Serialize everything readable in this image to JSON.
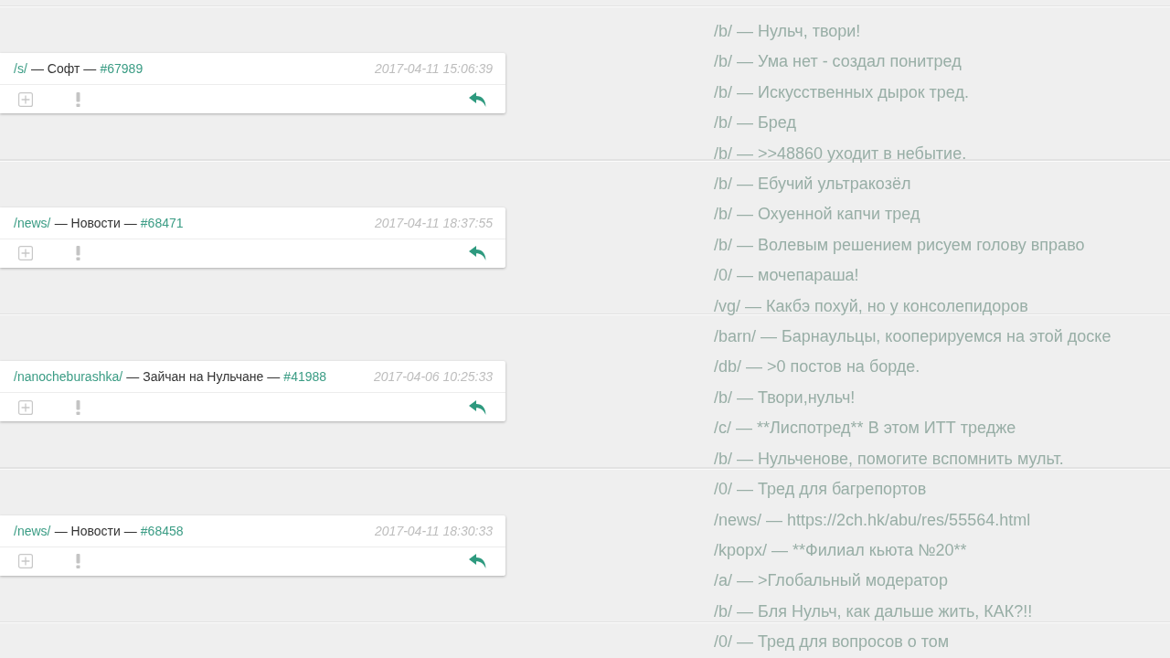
{
  "threads": [
    {
      "board": "/s/",
      "title": "— Софт —",
      "post": "#67989",
      "date": "2017-04-11 15:06:39"
    },
    {
      "board": "/news/",
      "title": "— Новости —",
      "post": "#68471",
      "date": "2017-04-11 18:37:55"
    },
    {
      "board": "/nanocheburashka/",
      "title": "— Зайчан на Нульчане —",
      "post": "#41988",
      "date": "2017-04-06 10:25:33"
    },
    {
      "board": "/news/",
      "title": "— Новости —",
      "post": "#68458",
      "date": "2017-04-11 18:30:33"
    }
  ],
  "recent_threads": [
    "/b/ — Нульч, твори!",
    "/b/ — Ума нет - создал понитред",
    "/b/ — Искусственных дырок тред.",
    "/b/ — Бред",
    "/b/ — >>48860 уходит в небытие.",
    "/b/ — Ебучий ультракозёл",
    "/b/ — Охуенной капчи тред",
    "/b/ — Волевым решением рисуем голову вправо",
    "/0/ — мочепараша!",
    "/vg/ — Какбэ похуй, но у консолепидоров",
    "/barn/ — Барнаульцы, кооперируемся на этой доске",
    "/db/ — >0 постов на борде.",
    "/b/ — Твори,нульч!",
    "/c/ — **Лиспотред** В этом ИТТ тредже",
    "/b/ — Нульченове, помогите вспомнить мульт.",
    "/0/ — Тред для багрепортов",
    "/news/ — https://2ch.hk/abu/res/55564.html",
    "/kpopx/ — **Филиал кьюта №20**",
    "/a/ — >Глобальный модератор",
    "/b/ — Бля Нульч, как дальше жить, КАК?!!",
    "/0/ — Тред для вопросов о том"
  ]
}
